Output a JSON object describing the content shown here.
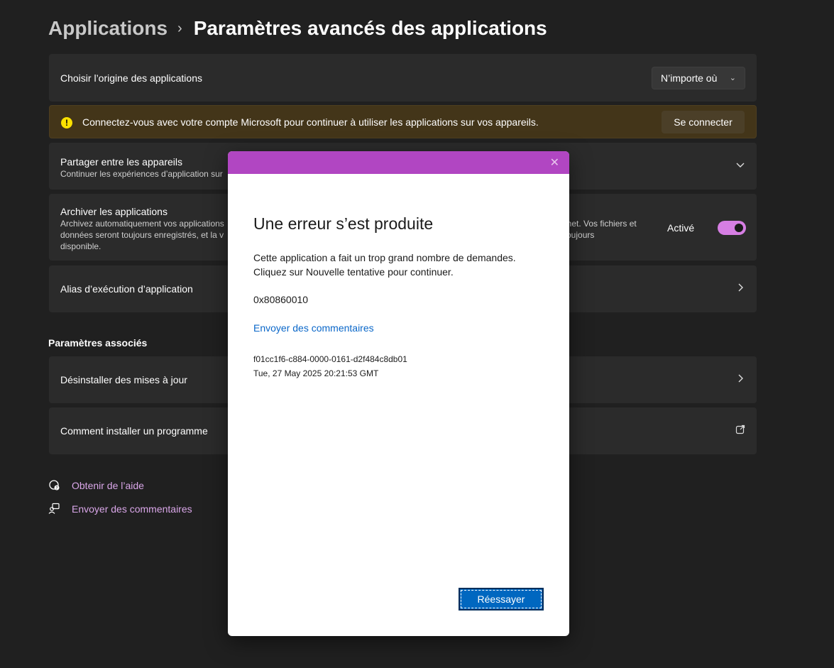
{
  "breadcrumb": {
    "parent": "Applications",
    "separator": "›",
    "current": "Paramètres avancés des applications"
  },
  "cards": {
    "origin": {
      "title": "Choisir l’origine des applications",
      "dropdown_value": "N’importe où"
    },
    "banner": {
      "icon": "warning-icon",
      "text": "Connectez-vous avec votre compte Microsoft pour continuer à utiliser les applications sur vos appareils.",
      "button": "Se connecter"
    },
    "share": {
      "title": "Partager entre les appareils",
      "subtitle": "Continuer les expériences d’application sur"
    },
    "archive": {
      "title": "Archiver les applications",
      "subtitle_left_1": "Archivez automatiquement vos applications",
      "subtitle_left_2": "données seront toujours enregistrés, et la v",
      "subtitle_left_3": "disponible.",
      "subtitle_right_1": "ernet. Vos fichiers et",
      "subtitle_right_2": "t toujours",
      "toggle_label": "Activé",
      "toggle_on": true
    },
    "alias": {
      "title": "Alias d’exécution d’application"
    }
  },
  "related": {
    "heading": "Paramètres associés",
    "uninstall": "Désinstaller des mises à jour",
    "install": "Comment installer un programme"
  },
  "links": {
    "help": "Obtenir de l’aide",
    "feedback": "Envoyer des commentaires"
  },
  "dialog": {
    "close": "✕",
    "title": "Une erreur s’est produite",
    "message_1": "Cette application a fait un trop grand nombre de demandes.",
    "message_2": "Cliquez sur Nouvelle tentative pour continuer.",
    "code": "0x80860010",
    "feedback_link": "Envoyer des commentaires",
    "correlation_id": "f01cc1f6-c884-0000-0161-d2f484c8db01",
    "timestamp": "Tue, 27 May 2025 20:21:53 GMT",
    "retry_button": "Réessayer",
    "titlebar_color": "#b146c2"
  },
  "colors": {
    "background": "#202020",
    "card": "#2b2b2b",
    "accent": "#d67ee3",
    "link": "#d9a6e8",
    "banner": "#433519",
    "button_blue": "#0067c0"
  }
}
